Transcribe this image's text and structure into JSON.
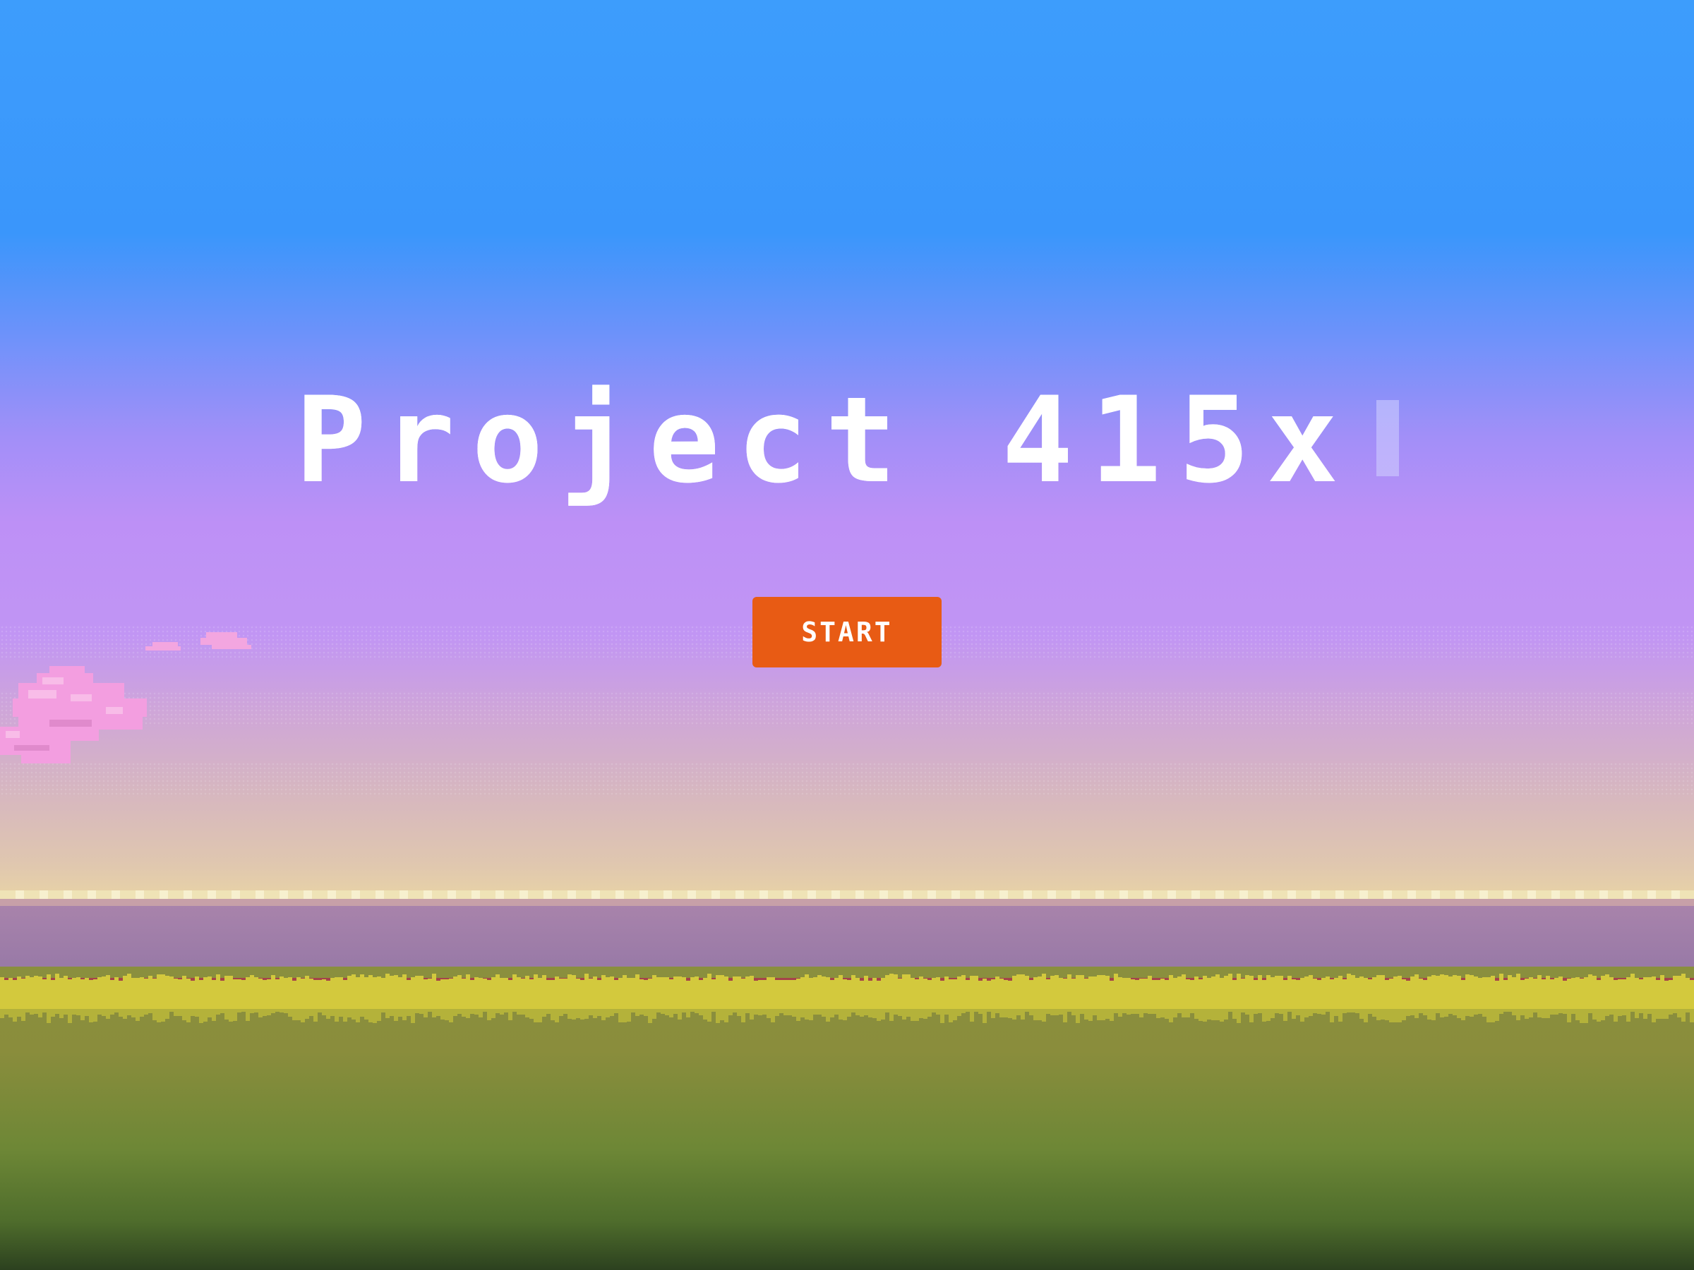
{
  "game": {
    "title": "Project 415x",
    "start_label": "START"
  },
  "colors": {
    "sky_top": "#3d9dfc",
    "sky_mid": "#bd90f6",
    "horizon": "#f4e0b2",
    "button": "#e85b14",
    "grass": "#d2c83c",
    "ground_bottom": "#2c411f",
    "cloud": "#f29adf"
  },
  "scene_elements": {
    "cloud_icon": "pink-pixel-cloud",
    "grass_icon": "pixel-grass-strip",
    "cursor_icon": "text-cursor-block"
  }
}
